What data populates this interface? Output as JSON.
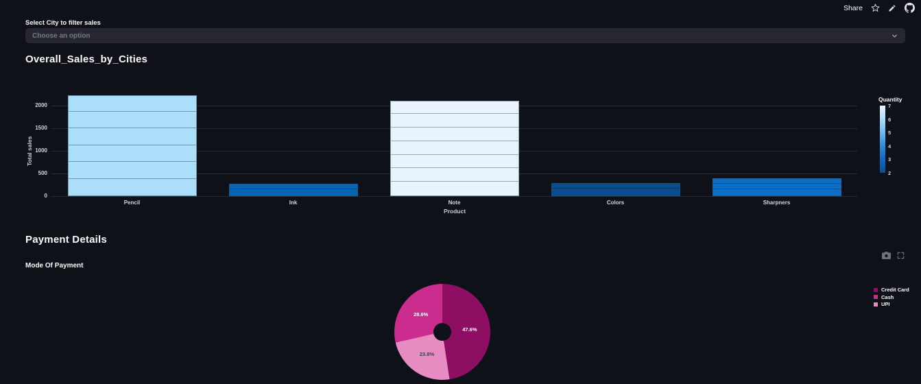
{
  "theme": {
    "background": "#0e1117",
    "secondary_background": "#262730",
    "text": "#fafafa",
    "tick_text": "#d2d7de",
    "axis_text": "#c6cbd3",
    "gridline": "#282c34"
  },
  "toolbar": {
    "share_label": "Share",
    "icons": [
      "star-icon",
      "edit-icon",
      "github-icon"
    ]
  },
  "filter": {
    "label": "Select City to filter sales",
    "placeholder": "Choose an option"
  },
  "sections": [
    {
      "title": "Overall_Sales_by_Cities"
    },
    {
      "title": "Payment Details",
      "subtitle": "Mode Of Payment"
    }
  ],
  "modebar_icons": [
    "camera-icon",
    "fullscreen-icon"
  ],
  "chart_data": [
    {
      "type": "bar",
      "stacked": true,
      "categories": [
        "Pencil",
        "Ink",
        "Note",
        "Colors",
        "Sharpners"
      ],
      "values": [
        2220,
        280,
        2100,
        290,
        390
      ],
      "segments": [
        6,
        2,
        7,
        2,
        3
      ],
      "bar_colors": [
        "#aadef9",
        "#0665b3",
        "#e8f3fc",
        "#0a4c8d",
        "#0d6ec6"
      ],
      "xlabel": "Product",
      "ylabel": "Total sales",
      "yticks": [
        0,
        500,
        1000,
        1500,
        2000
      ],
      "ylim": [
        0,
        2320
      ],
      "grid": true,
      "colorbar": {
        "title": "Quantity",
        "ticks": [
          7,
          6,
          5,
          4,
          3,
          2
        ],
        "stops": [
          "#ecf5fc",
          "#abdefa",
          "#6db9ee",
          "#2d8bd8",
          "#1069c1",
          "#0a4e94"
        ]
      }
    },
    {
      "type": "pie",
      "labels": [
        "Credit Card",
        "Cash",
        "UPI"
      ],
      "values": [
        47.6,
        28.6,
        23.8
      ],
      "slice_labels": [
        "47.6%",
        "28.6%",
        "23.8%"
      ],
      "colors": [
        "#8e0e63",
        "#cb2d8e",
        "#e78cc3"
      ],
      "label_colors": [
        "#ffffff",
        "#ffffff",
        "#3a3f4a"
      ],
      "draw_order": [
        0,
        2,
        1
      ],
      "hole": 0.18,
      "legend_position": "right"
    }
  ]
}
